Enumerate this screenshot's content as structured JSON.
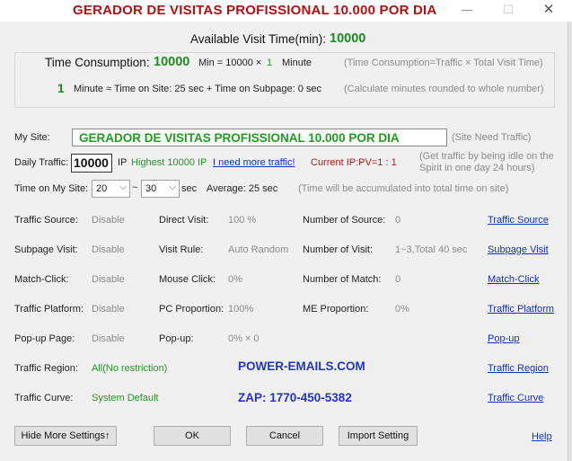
{
  "window": {
    "title": "GERADOR DE VISITAS PROFISSIONAL 10.000 POR DIA",
    "min_glyph": "—",
    "max_glyph": "☐",
    "close_glyph": "✕"
  },
  "summary": {
    "available_label": "Available Visit Time(min):",
    "available_value": "10000",
    "consumption_label": "Time Consumption:",
    "consumption_value": "10000",
    "consumption_formula": "Min = 10000 ×",
    "consumption_mult": "1",
    "consumption_unit": "Minute",
    "consumption_note": "(Time Consumption=Traffic × Total Visit Time)",
    "minute_value": "1",
    "minute_formula": "Minute ≈ Time on Site: 25 sec + Time on Subpage: 0 sec",
    "minute_note": "(Calculate minutes rounded to whole number)"
  },
  "site": {
    "label": "My Site:",
    "value": "GERADOR DE VISITAS PROFISSIONAL 10.000 POR DIA",
    "note": "(Site Need Traffic)"
  },
  "daily": {
    "label": "Daily Traffic:",
    "value": "10000",
    "unit": "IP",
    "highest": "Highest 10000 IP",
    "more_link": "I need more traffic!",
    "current_ip": "Current IP:PV=1 : 1",
    "note_line1": "(Get traffic by being idle on the",
    "note_line2": "Spirit in one day 24 hours)"
  },
  "time_on_site": {
    "label": "Time on My Site:",
    "from": "20",
    "tilde": "~",
    "to": "30",
    "unit": "sec",
    "average": "Average: 25 sec",
    "note": "(Time will be accumulated into total time on site)"
  },
  "settings": {
    "traffic_source_label": "Traffic Source:",
    "traffic_source_value": "Disable",
    "direct_visit_label": "Direct Visit:",
    "direct_visit_value": "100 %",
    "number_of_source_label": "Number of Source:",
    "number_of_source_value": "0",
    "subpage_visit_label": "Subpage Visit:",
    "subpage_visit_value": "Disable",
    "visit_rule_label": "Visit Rule:",
    "visit_rule_value": "Auto Random",
    "number_of_visit_label": "Number of Visit:",
    "number_of_visit_value": "1~3,Total 40 sec",
    "match_click_label": "Match-Click:",
    "match_click_value": "Disable",
    "mouse_click_label": "Mouse Click:",
    "mouse_click_value": "0%",
    "number_of_match_label": "Number of Match:",
    "number_of_match_value": "0",
    "traffic_platform_label": "Traffic Platform:",
    "traffic_platform_value": "Disable",
    "pc_proportion_label": "PC Proportion:",
    "pc_proportion_value": "100%",
    "me_proportion_label": "ME Proportion:",
    "me_proportion_value": "0%",
    "popup_page_label": "Pop-up Page:",
    "popup_page_value": "Disable",
    "popup_label": "Pop-up:",
    "popup_value": "0% × 0",
    "traffic_region_label": "Traffic Region:",
    "traffic_region_value": "All(No restriction)",
    "traffic_curve_label": "Traffic Curve:",
    "traffic_curve_value": "System Default"
  },
  "links": {
    "traffic_source": "Traffic Source",
    "subpage_visit": "Subpage Visit",
    "match_click": "Match-Click",
    "traffic_platform": "Traffic Platform",
    "popup": "Pop-up",
    "traffic_region": "Traffic Region",
    "traffic_curve": "Traffic Curve"
  },
  "promo": {
    "email": "POWER-EMAILS.COM",
    "zap": "ZAP:  1770-450-5382"
  },
  "buttons": {
    "hide_more": "Hide More Settings↑",
    "ok": "OK",
    "cancel": "Cancel",
    "import": "Import Setting",
    "help": "Help"
  },
  "colors": {
    "title_red": "#b01212",
    "value_green": "#1f9a1f",
    "link_blue": "#1030c0",
    "promo_blue": "#2434c8"
  }
}
